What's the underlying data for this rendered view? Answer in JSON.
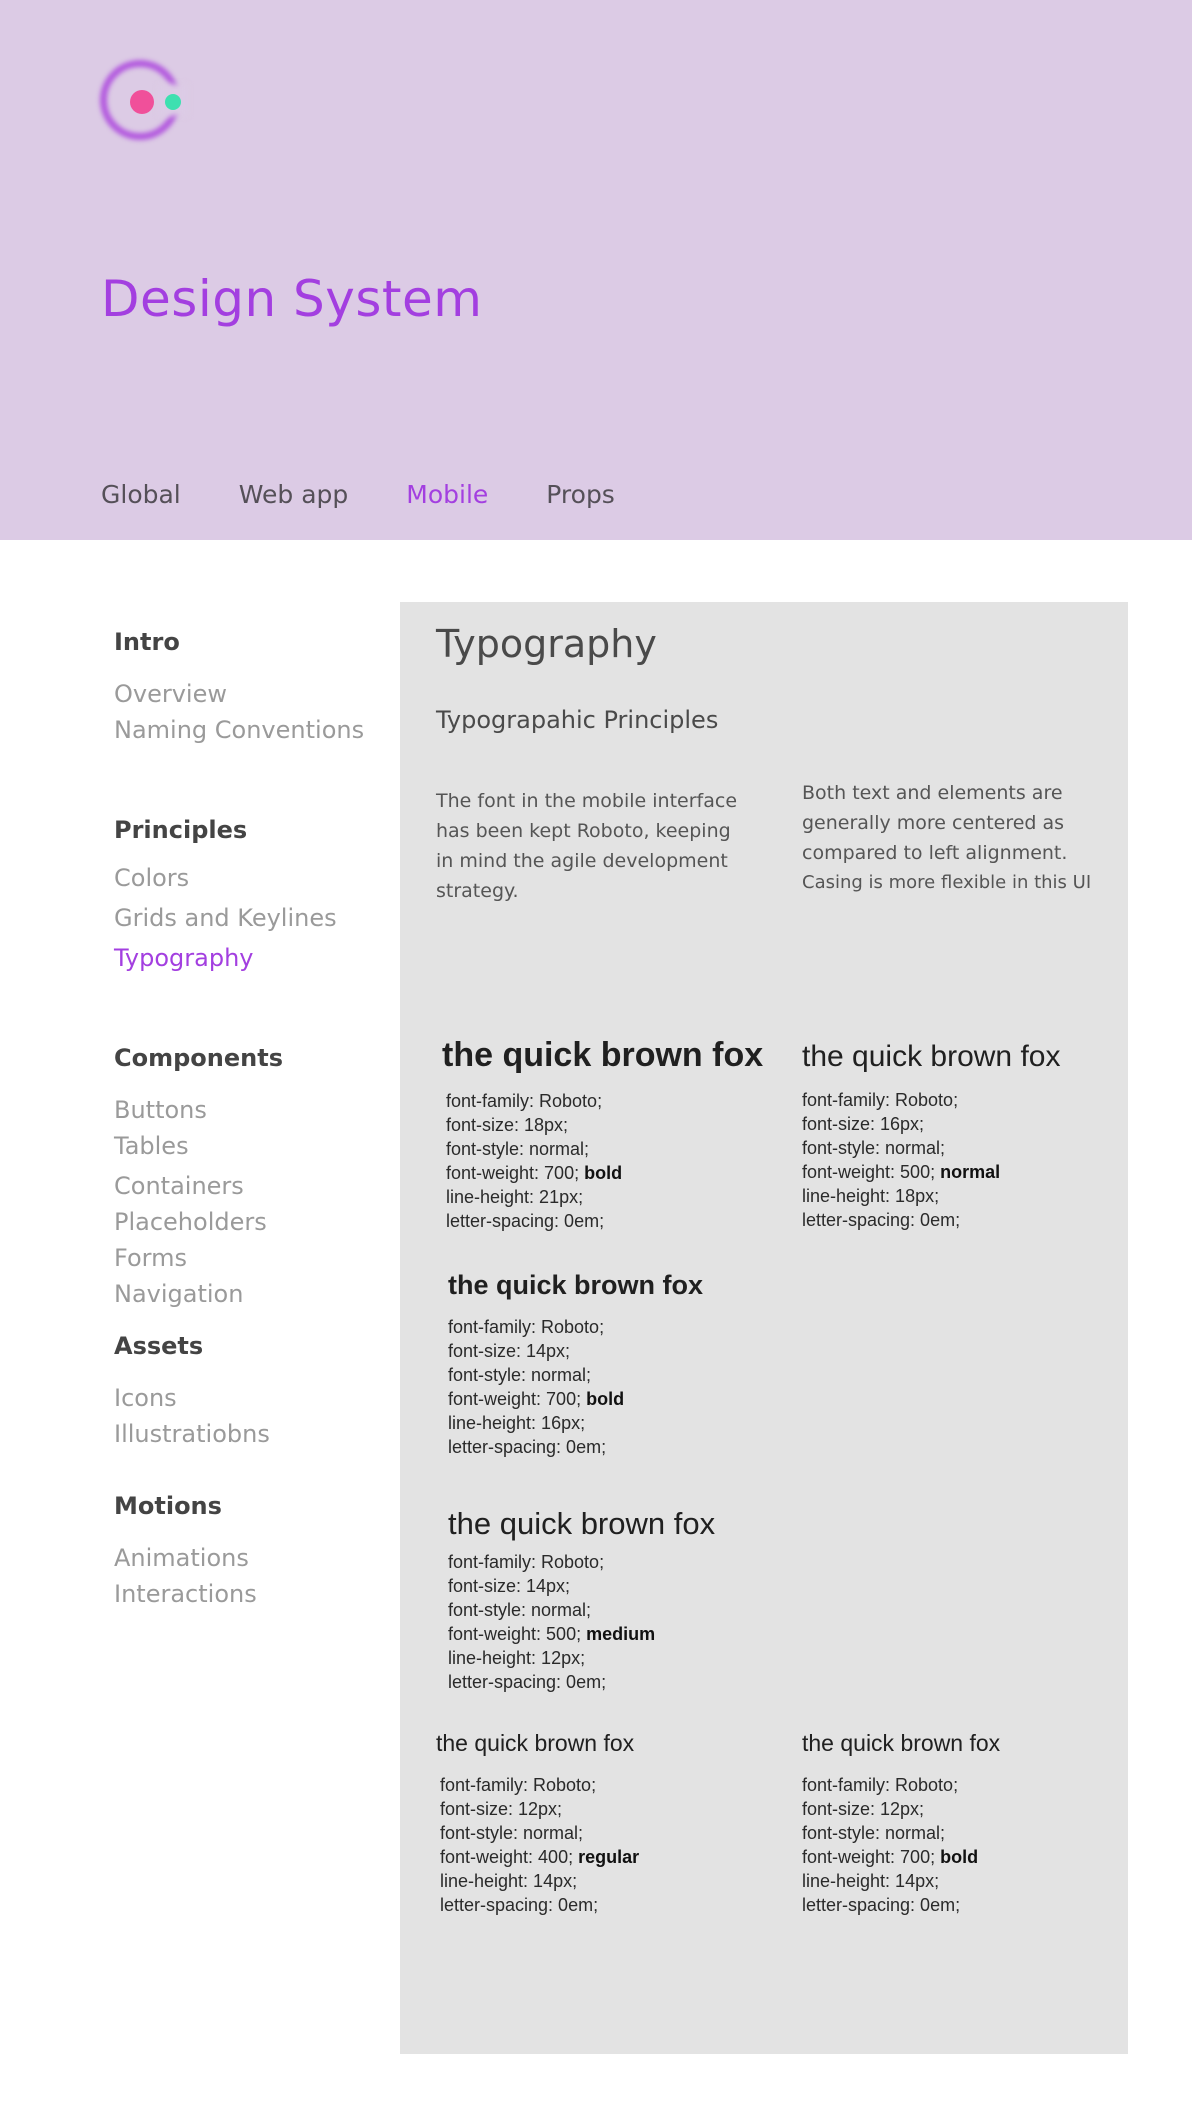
{
  "header": {
    "title": "Design System",
    "tabs": [
      {
        "label": "Global",
        "active": false
      },
      {
        "label": "Web app",
        "active": false
      },
      {
        "label": "Mobile",
        "active": true
      },
      {
        "label": "Props",
        "active": false
      }
    ],
    "colors": {
      "background": "#dccbe5",
      "accent": "#a33fe0",
      "logo_ring": "#b35ade",
      "logo_pink": "#f0509a",
      "logo_green": "#3ee0b0"
    }
  },
  "sidebar": {
    "intro": {
      "heading": "Intro",
      "items": [
        "Overview",
        "Naming Conventions"
      ]
    },
    "principles": {
      "heading": "Principles",
      "items": [
        "Colors",
        "Grids and Keylines",
        "Typography"
      ],
      "active": "Typography"
    },
    "components": {
      "heading": "Components",
      "items": [
        "Buttons",
        "Tables",
        "Containers",
        "Placeholders",
        "Forms",
        "Navigation"
      ]
    },
    "assets": {
      "heading": "Assets",
      "items": [
        "Icons",
        "Illustratiobns"
      ]
    },
    "motions": {
      "heading": "Motions",
      "items": [
        "Animations",
        "Interactions"
      ]
    }
  },
  "main": {
    "title": "Typography",
    "subtitle": "Typograpahic Principles",
    "para_left": [
      "The font in the mobile interface",
      "has been kept Roboto, keeping",
      "in mind the agile development",
      "strategy."
    ],
    "para_right": [
      "Both text and elements are",
      "generally more centered as",
      "compared to left alignment.",
      "Casing is more flexible in this UI"
    ],
    "samples": [
      {
        "sample": "the quick brown fox",
        "family": "font-family: Roboto;",
        "size": "font-size: 18px;",
        "style": "font-style: normal;",
        "weight": "font-weight: 700;",
        "weight_name": "bold",
        "line_height": "line-height: 21px;",
        "spacing": "letter-spacing: 0em;"
      },
      {
        "sample": "the quick brown fox",
        "family": "font-family: Roboto;",
        "size": "font-size: 16px;",
        "style": "font-style: normal;",
        "weight": "font-weight: 500;",
        "weight_name": "normal",
        "line_height": "line-height: 18px;",
        "spacing": "letter-spacing: 0em;"
      },
      {
        "sample": "the quick brown fox",
        "family": "font-family: Roboto;",
        "size": "font-size: 14px;",
        "style": "font-style: normal;",
        "weight": "font-weight: 700;",
        "weight_name": "bold",
        "line_height": "line-height: 16px;",
        "spacing": "letter-spacing: 0em;"
      },
      {
        "sample": "the quick brown fox",
        "family": "font-family: Roboto;",
        "size": "font-size: 14px;",
        "style": "font-style: normal;",
        "weight": "font-weight: 500;",
        "weight_name": "medium",
        "line_height": "line-height: 12px;",
        "spacing": "letter-spacing: 0em;"
      },
      {
        "sample": "the quick brown fox",
        "family": "font-family: Roboto;",
        "size": "font-size: 12px;",
        "style": "font-style: normal;",
        "weight": "font-weight: 400;",
        "weight_name": "regular",
        "line_height": "line-height: 14px;",
        "spacing": "letter-spacing: 0em;"
      },
      {
        "sample": "the quick brown fox",
        "family": "font-family: Roboto;",
        "size": "font-size: 12px;",
        "style": "font-style: normal;",
        "weight": "font-weight: 700;",
        "weight_name": "bold",
        "line_height": "line-height: 14px;",
        "spacing": "letter-spacing: 0em;"
      }
    ]
  }
}
